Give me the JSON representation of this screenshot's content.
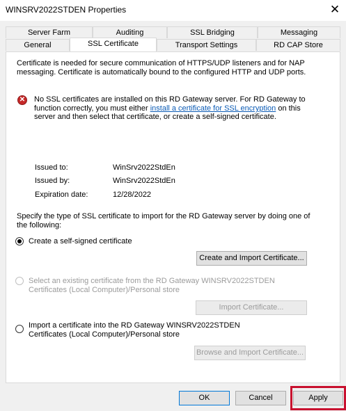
{
  "window": {
    "title": "WINSRV2022STDEN Properties",
    "close_glyph": "✕"
  },
  "tabs": {
    "row1": [
      "Server Farm",
      "Auditing",
      "SSL Bridging",
      "Messaging"
    ],
    "row2": [
      "General",
      "SSL Certificate",
      "Transport Settings",
      "RD CAP Store"
    ],
    "active": "SSL Certificate"
  },
  "content": {
    "intro_line1": "Certificate is needed for secure communication of HTTPS/UDP listeners and for NAP",
    "intro_line2": "messaging. Certificate is automatically bound to the configured HTTP and UDP ports.",
    "error_icon": "error-icon",
    "error_line1": "No SSL certificates are installed on this RD Gateway server. For RD Gateway to",
    "error_line2_pre": "function correctly, you must either ",
    "error_link": "install a certificate for SSL encryption",
    "error_line2_post": " on this",
    "error_line3": "server and then select that certificate, or create a self-signed certificate.",
    "cert": {
      "issued_to_label": "Issued to:",
      "issued_to_value": "WinSrv2022StdEn",
      "issued_by_label": "Issued by:",
      "issued_by_value": "WinSrv2022StdEn",
      "expiration_label": "Expiration date:",
      "expiration_value": "12/28/2022"
    },
    "specify_line1": "Specify the type of SSL certificate to import for the RD Gateway server by doing one of",
    "specify_line2": "the following:",
    "option1_label": "Create a self-signed certificate",
    "option1_button": "Create and Import Certificate...",
    "option2_line1": "Select an existing certificate from the RD Gateway WINSRV2022STDEN",
    "option2_line2": "Certificates (Local Computer)/Personal store",
    "option2_button": "Import Certificate...",
    "option3_line1": "Import a certificate into the RD Gateway WINSRV2022STDEN",
    "option3_line2": "Certificates (Local Computer)/Personal store",
    "option3_button": "Browse and Import Certificate..."
  },
  "footer": {
    "ok": "OK",
    "cancel": "Cancel",
    "apply": "Apply"
  },
  "colors": {
    "link": "#0b5bb5",
    "highlight": "#c8102e",
    "error": "#c62828"
  }
}
